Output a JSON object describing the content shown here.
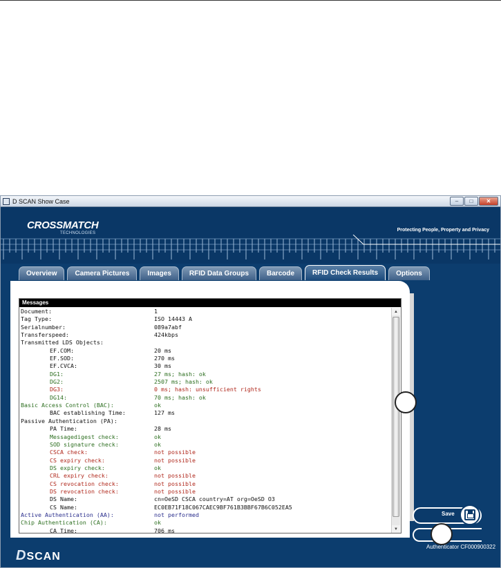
{
  "window": {
    "title": "D SCAN Show Case",
    "controls": [
      "–",
      "□",
      "✕"
    ]
  },
  "header": {
    "logo": "CROSSMATCH",
    "logo_sub": "TECHNOLOGIES",
    "tagline": "Protecting People, Property and Privacy"
  },
  "tabs": [
    {
      "label": "Overview",
      "active": false
    },
    {
      "label": "Camera Pictures",
      "active": false
    },
    {
      "label": "Images",
      "active": false
    },
    {
      "label": "RFID Data Groups",
      "active": false
    },
    {
      "label": "Barcode",
      "active": false
    },
    {
      "label": "RFID Check Results",
      "active": true
    },
    {
      "label": "Options",
      "active": false
    }
  ],
  "messages": {
    "header": "Messages",
    "rows": [
      {
        "key": "Document:",
        "value": "1",
        "indent": 0,
        "color": "black"
      },
      {
        "key": "Tag Type:",
        "value": "ISO 14443 A",
        "indent": 0,
        "color": "black"
      },
      {
        "key": "Serialnumber:",
        "value": "089a7abf",
        "indent": 0,
        "color": "black"
      },
      {
        "key": "Transferspeed:",
        "value": "424kbps",
        "indent": 0,
        "color": "black"
      },
      {
        "key": "Transmitted LDS Objects:",
        "value": "",
        "indent": 0,
        "color": "black"
      },
      {
        "key": "EF.COM:",
        "value": "20 ms",
        "indent": 1,
        "color": "black"
      },
      {
        "key": "EF.SOD:",
        "value": "270 ms",
        "indent": 1,
        "color": "black"
      },
      {
        "key": "EF.CVCA:",
        "value": "30 ms",
        "indent": 1,
        "color": "black"
      },
      {
        "key": "DG1:",
        "value": "27 ms; hash: ok",
        "indent": 1,
        "color": "green"
      },
      {
        "key": "DG2:",
        "value": "2507 ms; hash: ok",
        "indent": 1,
        "color": "green"
      },
      {
        "key": "DG3:",
        "value": "0 ms; hash: unsufficient rights",
        "indent": 1,
        "color": "red"
      },
      {
        "key": "DG14:",
        "value": "70 ms; hash: ok",
        "indent": 1,
        "color": "green"
      },
      {
        "key": "Basic Access Control (BAC):",
        "value": "ok",
        "indent": 0,
        "color": "green"
      },
      {
        "key": "BAC establishing Time:",
        "value": "127 ms",
        "indent": 1,
        "color": "black"
      },
      {
        "key": "Passive Authentication (PA):",
        "value": "",
        "indent": 0,
        "color": "black"
      },
      {
        "key": "PA Time:",
        "value": "28 ms",
        "indent": 1,
        "color": "black"
      },
      {
        "key": "Messagedigest check:",
        "value": "ok",
        "indent": 1,
        "color": "green"
      },
      {
        "key": "SOD signature check:",
        "value": "ok",
        "indent": 1,
        "color": "green"
      },
      {
        "key": "CSCA check:",
        "value": "not possible",
        "indent": 1,
        "color": "red"
      },
      {
        "key": "CS expiry check:",
        "value": "not possible",
        "indent": 1,
        "color": "red"
      },
      {
        "key": "DS expiry check:",
        "value": "ok",
        "indent": 1,
        "color": "green"
      },
      {
        "key": "CRL expiry check:",
        "value": "not possible",
        "indent": 1,
        "color": "red"
      },
      {
        "key": "CS revocation check:",
        "value": "not possible",
        "indent": 1,
        "color": "red"
      },
      {
        "key": "DS revocation check:",
        "value": "not possible",
        "indent": 1,
        "color": "red"
      },
      {
        "key": "DS Name:",
        "value": "cn=OeSD CSCA country=AT org=OeSD O3",
        "indent": 1,
        "color": "black"
      },
      {
        "key": "CS Name:",
        "value": "EC0EB71F18C067CAEC9BF761B3BBF67B6C052EA5",
        "indent": 1,
        "color": "black"
      },
      {
        "key": "Active Authentication (AA):",
        "value": "not performed",
        "indent": 0,
        "color": "blue"
      },
      {
        "key": "Chip Authentication (CA):",
        "value": "ok",
        "indent": 0,
        "color": "green"
      },
      {
        "key": "CA Time:",
        "value": "706 ms",
        "indent": 1,
        "color": "black"
      }
    ]
  },
  "actions": {
    "save_label": "Save"
  },
  "footer": {
    "brand": "SCAN",
    "brand_mark": "D",
    "device_id": "Authenticator CF000900322"
  },
  "colors": {
    "window_bg": "#0c3d6e",
    "ok_green": "#2c6e1f",
    "error_red": "#b0281c",
    "info_blue": "#2a2e8c"
  }
}
